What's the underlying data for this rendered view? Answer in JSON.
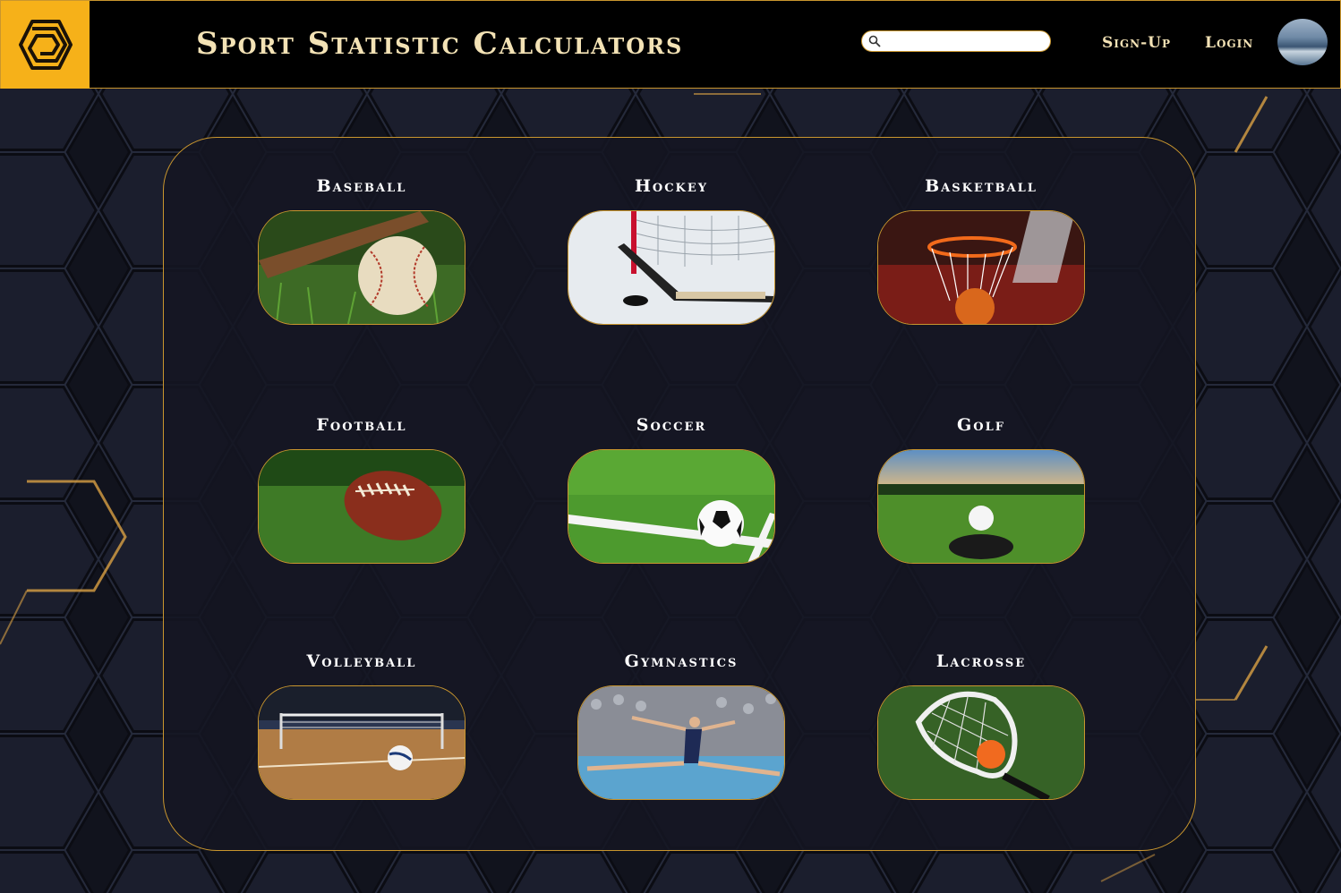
{
  "header": {
    "title": "Sport Statistic Calculators",
    "search_placeholder": "",
    "signup_label": "Sign-Up",
    "login_label": "Login"
  },
  "sports": [
    {
      "label": "Baseball"
    },
    {
      "label": "Hockey"
    },
    {
      "label": "Basketball"
    },
    {
      "label": "Football"
    },
    {
      "label": "Soccer"
    },
    {
      "label": "Golf"
    },
    {
      "label": "Volleyball"
    },
    {
      "label": "Gymnastics"
    },
    {
      "label": "Lacrosse"
    }
  ],
  "colors": {
    "accent_gold": "#c9962e",
    "logo_bg": "#f6b119",
    "title_cream": "#f3e2b5",
    "header_bg": "#000000",
    "page_bg": "#11131d"
  },
  "icons": [
    "logo-icon",
    "search-icon",
    "user-avatar"
  ]
}
